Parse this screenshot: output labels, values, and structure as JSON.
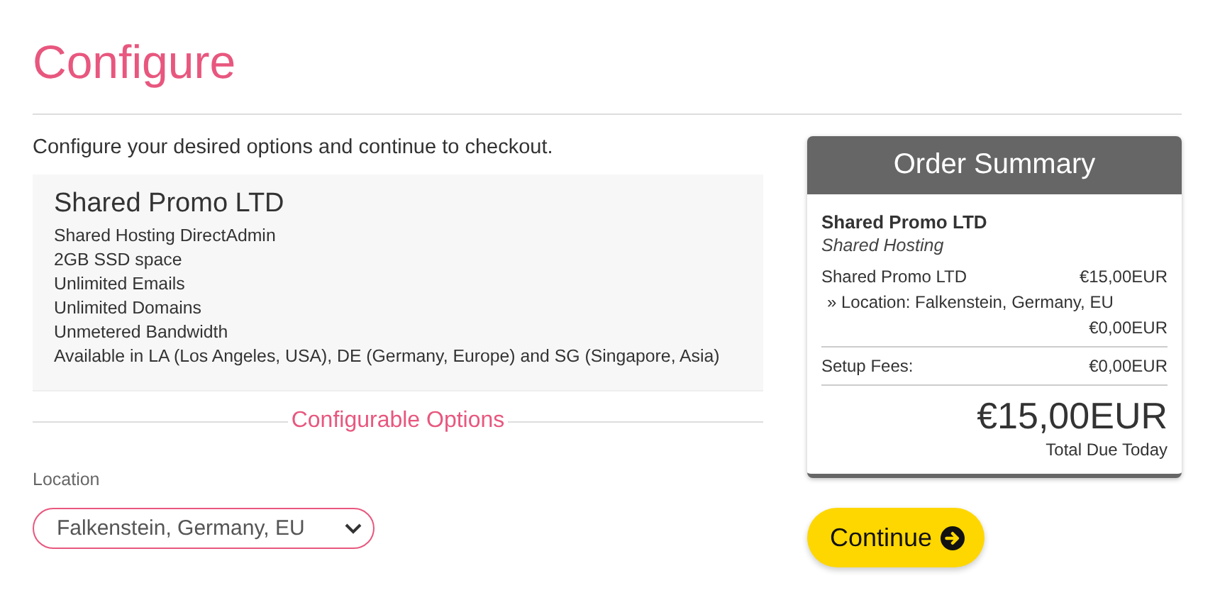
{
  "page_title": "Configure",
  "intro": "Configure your desired options and continue to checkout.",
  "product": {
    "name": "Shared Promo LTD",
    "features": [
      "Shared Hosting DirectAdmin",
      "2GB SSD space",
      "Unlimited Emails",
      "Unlimited Domains",
      "Unmetered Bandwidth",
      "Available in LA (Los Angeles, USA), DE (Germany, Europe) and SG (Singapore, Asia)"
    ]
  },
  "section_title": "Configurable Options",
  "options": [
    {
      "label": "Location",
      "value": "Falkenstein, Germany, EU"
    }
  ],
  "summary": {
    "title": "Order Summary",
    "product_name": "Shared Promo LTD",
    "product_group": "Shared Hosting",
    "lines": [
      {
        "label": "Shared Promo LTD",
        "price": "€15,00EUR"
      },
      {
        "label": "» Location: Falkenstein, Germany, EU",
        "price": "€0,00EUR"
      }
    ],
    "setup_label": "Setup Fees:",
    "setup_price": "€0,00EUR",
    "total": "€15,00EUR",
    "total_label": "Total Due Today"
  },
  "continue_button": "Continue"
}
